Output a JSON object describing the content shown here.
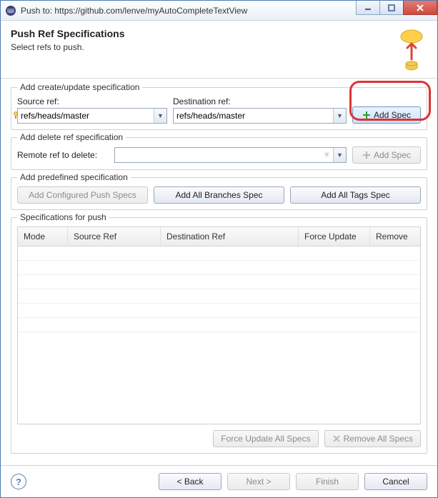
{
  "window": {
    "title": "Push to: https://github.com/lenve/myAutoCompleteTextView"
  },
  "header": {
    "title": "Push Ref Specifications",
    "subtitle": "Select refs to push."
  },
  "groups": {
    "create": {
      "title": "Add create/update specification",
      "source_label": "Source ref:",
      "source_value": "refs/heads/master",
      "dest_label": "Destination ref:",
      "dest_value": "refs/heads/master",
      "add_label": "Add Spec"
    },
    "delete": {
      "title": "Add delete ref specification",
      "remote_label": "Remote ref to delete:",
      "remote_value": "",
      "add_label": "Add Spec"
    },
    "predefined": {
      "title": "Add predefined specification",
      "configured": "Add Configured Push Specs",
      "all_branches": "Add All Branches Spec",
      "all_tags": "Add All Tags Spec"
    },
    "specs": {
      "title": "Specifications for push",
      "columns": [
        "Mode",
        "Source Ref",
        "Destination Ref",
        "Force Update",
        "Remove"
      ],
      "force_all": "Force Update All Specs",
      "remove_all": "Remove All Specs"
    }
  },
  "footer": {
    "back": "< Back",
    "next": "Next >",
    "finish": "Finish",
    "cancel": "Cancel"
  }
}
